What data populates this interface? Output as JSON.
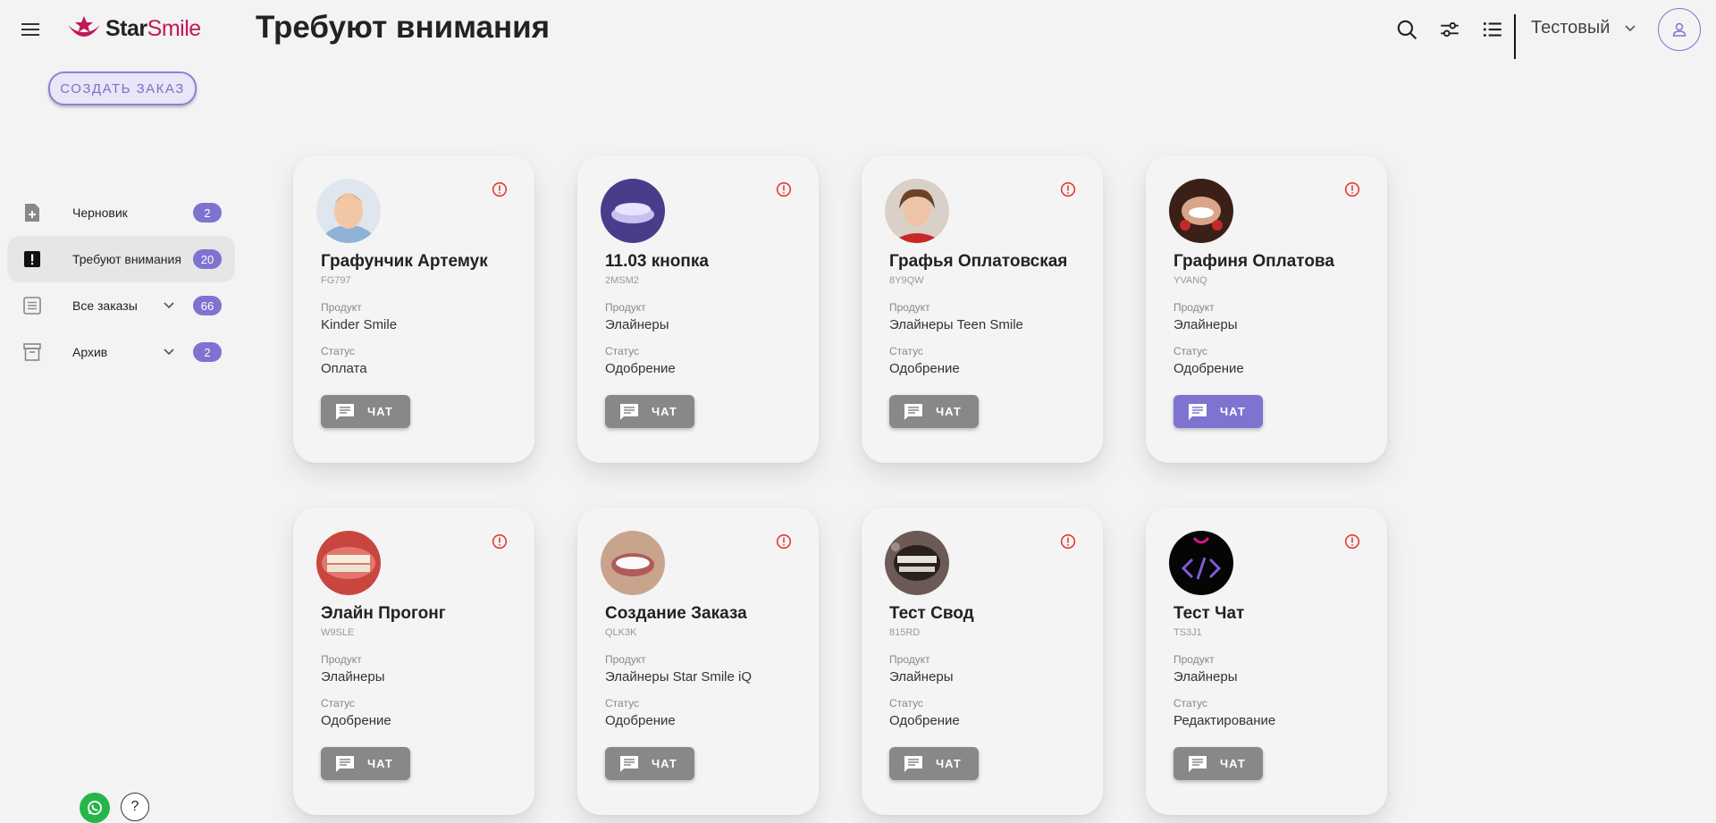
{
  "header": {
    "logo_star": "Star",
    "logo_smile": "Smile",
    "title": "Требуют внимания",
    "user_name": "Тестовый"
  },
  "create_button": "СОЗДАТЬ ЗАКАЗ",
  "sidebar": {
    "items": [
      {
        "label": "Черновик",
        "badge": "2",
        "icon": "draft-icon"
      },
      {
        "label": "Требуют внимания",
        "badge": "20",
        "icon": "attention-icon"
      },
      {
        "label": "Все заказы",
        "badge": "66",
        "icon": "list-icon"
      },
      {
        "label": "Архив",
        "badge": "2",
        "icon": "archive-icon"
      }
    ]
  },
  "help_label": "?",
  "cards": [
    {
      "name": "Графунчик Артемук",
      "code": "FG797",
      "product_label": "Продукт",
      "product": "Kinder Smile",
      "status_label": "Статус",
      "status": "Оплата",
      "chat": "ЧАТ"
    },
    {
      "name": "11.03 кнопка",
      "code": "2MSM2",
      "product_label": "Продукт",
      "product": "Элайнеры",
      "status_label": "Статус",
      "status": "Одобрение",
      "chat": "ЧАТ"
    },
    {
      "name": "Графья Оплатовская",
      "code": "8Y9QW",
      "product_label": "Продукт",
      "product": "Элайнеры Teen Smile",
      "status_label": "Статус",
      "status": "Одобрение",
      "chat": "ЧАТ"
    },
    {
      "name": "Графиня Оплатова",
      "code": "YVANQ",
      "product_label": "Продукт",
      "product": "Элайнеры",
      "status_label": "Статус",
      "status": "Одобрение",
      "chat": "ЧАТ"
    },
    {
      "name": "Элайн Прогонг",
      "code": "W9SLE",
      "product_label": "Продукт",
      "product": "Элайнеры",
      "status_label": "Статус",
      "status": "Одобрение",
      "chat": "ЧАТ"
    },
    {
      "name": "Создание Заказа",
      "code": "QLK3K",
      "product_label": "Продукт",
      "product": "Элайнеры Star Smile iQ",
      "status_label": "Статус",
      "status": "Одобрение",
      "chat": "ЧАТ"
    },
    {
      "name": "Тест Свод",
      "code": "815RD",
      "product_label": "Продукт",
      "product": "Элайнеры",
      "status_label": "Статус",
      "status": "Одобрение",
      "chat": "ЧАТ"
    },
    {
      "name": "Тест Чат",
      "code": "TS3J1",
      "product_label": "Продукт",
      "product": "Элайнеры",
      "status_label": "Статус",
      "status": "Редактирование",
      "chat": "ЧАТ"
    }
  ],
  "colors": {
    "accent": "#7f73d1",
    "brand": "#c2185b",
    "chat_button": "#888888",
    "alert": "#e53935",
    "whatsapp": "#25b64a"
  }
}
